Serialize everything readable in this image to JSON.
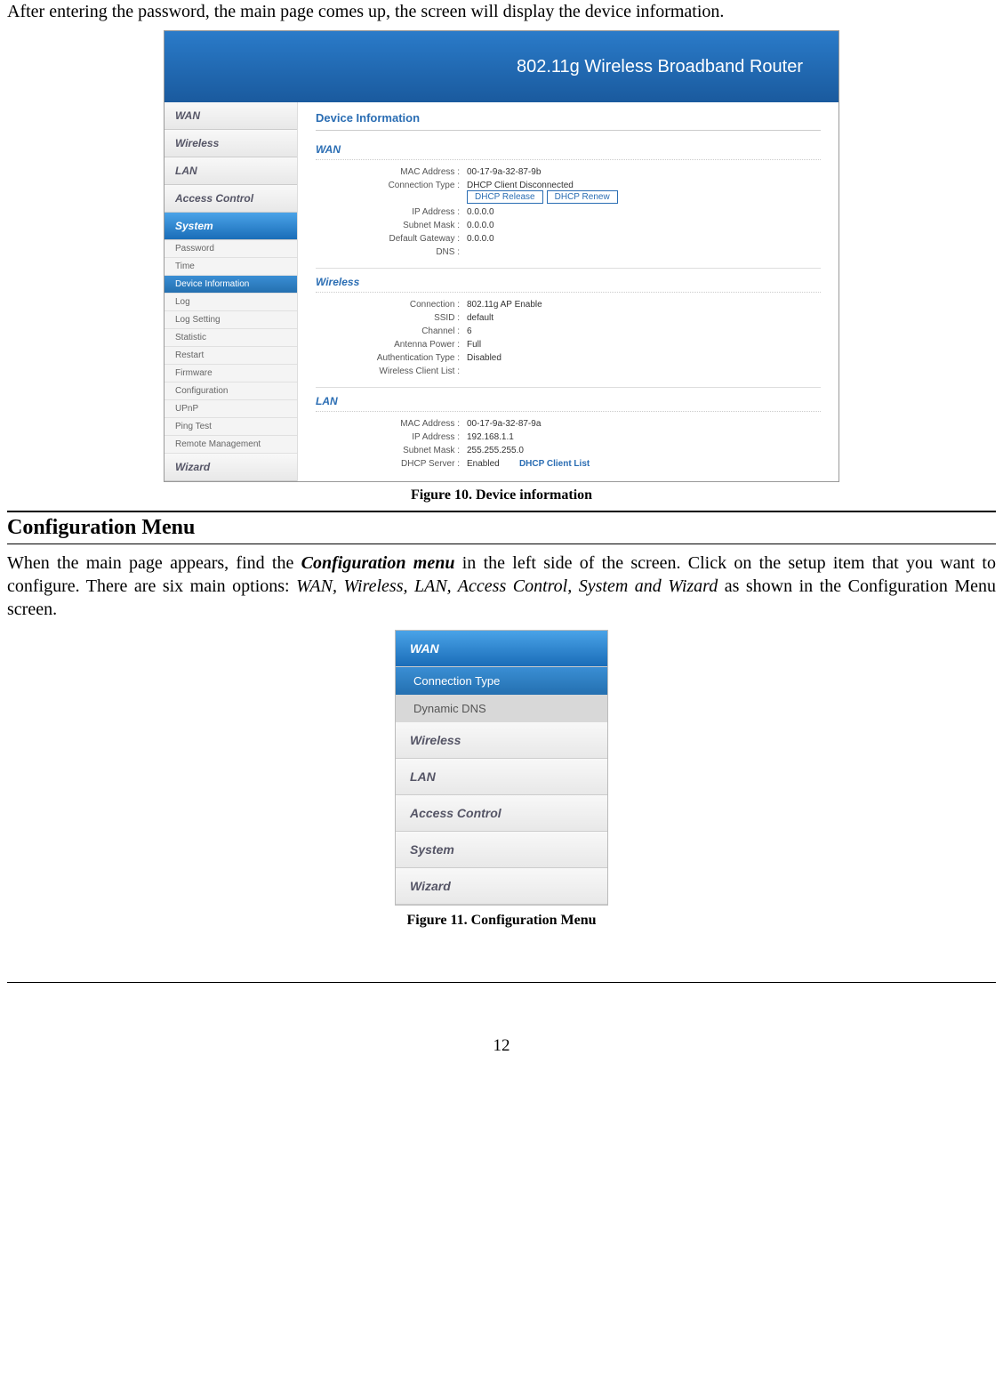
{
  "intro": "After entering the password, the main page comes up, the screen will display the device information.",
  "router": {
    "headerTitle": "802.11g Wireless Broadband Router",
    "sidebar": {
      "wan": "WAN",
      "wireless": "Wireless",
      "lan": "LAN",
      "accessControl": "Access Control",
      "system": "System",
      "subs": {
        "password": "Password",
        "time": "Time",
        "deviceInfo": "Device Information",
        "log": "Log",
        "logSetting": "Log Setting",
        "statistic": "Statistic",
        "restart": "Restart",
        "firmware": "Firmware",
        "configuration": "Configuration",
        "upnp": "UPnP",
        "pingTest": "Ping Test",
        "remoteMgmt": "Remote Management"
      },
      "wizard": "Wizard"
    },
    "panel": {
      "title": "Device Information",
      "wan": {
        "heading": "WAN",
        "macLabel": "MAC Address :",
        "macValue": "00-17-9a-32-87-9b",
        "connTypeLabel": "Connection Type :",
        "connTypeValue": "DHCP Client Disconnected",
        "dhcpRelease": "DHCP Release",
        "dhcpRenew": "DHCP Renew",
        "ipLabel": "IP Address :",
        "ipValue": "0.0.0.0",
        "subnetLabel": "Subnet Mask :",
        "subnetValue": "0.0.0.0",
        "gatewayLabel": "Default Gateway :",
        "gatewayValue": "0.0.0.0",
        "dnsLabel": "DNS :",
        "dnsValue": ""
      },
      "wireless": {
        "heading": "Wireless",
        "connLabel": "Connection :",
        "connValue": "802.11g AP Enable",
        "ssidLabel": "SSID :",
        "ssidValue": "default",
        "channelLabel": "Channel :",
        "channelValue": "6",
        "antennaLabel": "Antenna Power :",
        "antennaValue": "Full",
        "authLabel": "Authentication Type :",
        "authValue": "Disabled",
        "clientListLabel": "Wireless Client List :",
        "clientListValue": ""
      },
      "lan": {
        "heading": "LAN",
        "macLabel": "MAC Address :",
        "macValue": "00-17-9a-32-87-9a",
        "ipLabel": "IP Address :",
        "ipValue": "192.168.1.1",
        "subnetLabel": "Subnet Mask :",
        "subnetValue": "255.255.255.0",
        "dhcpLabel": "DHCP Server :",
        "dhcpValue": "Enabled",
        "dhcpClientList": "DHCP Client List"
      }
    }
  },
  "fig10": "Figure 10. Device information",
  "heading2": "Configuration Menu",
  "body2a": "When the main page appears, find the ",
  "body2b": "Configuration menu",
  "body2c": " in the left side of the screen. Click on the setup item that you want to configure. There are six main options: ",
  "body2d": "WAN, Wireless, LAN, Access Control, System and Wizard",
  "body2e": " as shown in the Configuration Menu screen.",
  "menu2": {
    "wan": "WAN",
    "connType": "Connection Type",
    "dynDns": "Dynamic DNS",
    "wireless": "Wireless",
    "lan": "LAN",
    "accessControl": "Access Control",
    "system": "System",
    "wizard": "Wizard"
  },
  "fig11": "Figure 11. Configuration Menu",
  "pageNum": "12"
}
